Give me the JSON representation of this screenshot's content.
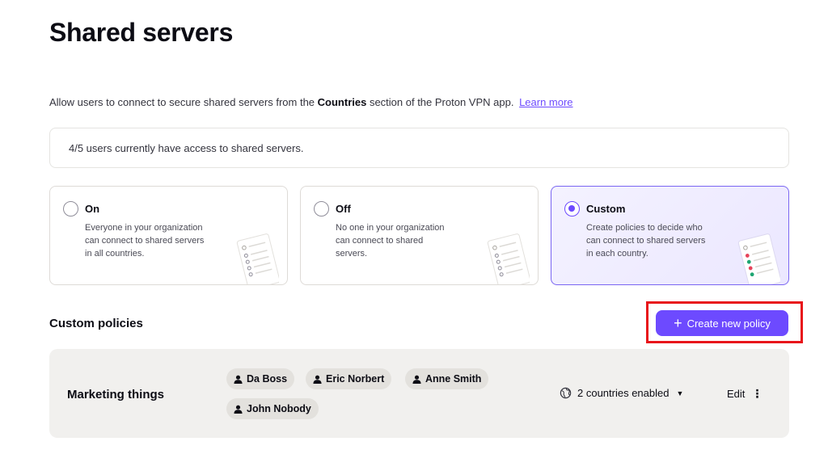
{
  "page": {
    "title": "Shared servers"
  },
  "description": {
    "before": "Allow users to connect to secure shared servers from the ",
    "bold": "Countries",
    "after": " section of the Proton VPN app.",
    "link": "Learn more"
  },
  "access_info": "4/5 users currently have access to shared servers.",
  "options": [
    {
      "title": "On",
      "description": "Everyone in your organization can connect to shared servers in all countries.",
      "selected": false
    },
    {
      "title": "Off",
      "description": "No one in your organization can connect to shared servers.",
      "selected": false
    },
    {
      "title": "Custom",
      "description": "Create policies to decide who can connect to shared servers in each country.",
      "selected": true
    }
  ],
  "custom_policies": {
    "title": "Custom policies",
    "create_button": "Create new policy",
    "policies": [
      {
        "name": "Marketing things",
        "users": [
          "Da Boss",
          "Eric Norbert",
          "Anne Smith",
          "John Nobody"
        ],
        "countries": "2 countries enabled",
        "edit_label": "Edit"
      }
    ]
  },
  "colors": {
    "accent": "#6d4aff",
    "highlight": "#e8141a",
    "policy_bg": "#f1f0ee"
  },
  "icons": [
    "user-icon",
    "globe-icon",
    "caret-down-icon",
    "kebab-icon",
    "plus-icon",
    "radio-icon"
  ]
}
